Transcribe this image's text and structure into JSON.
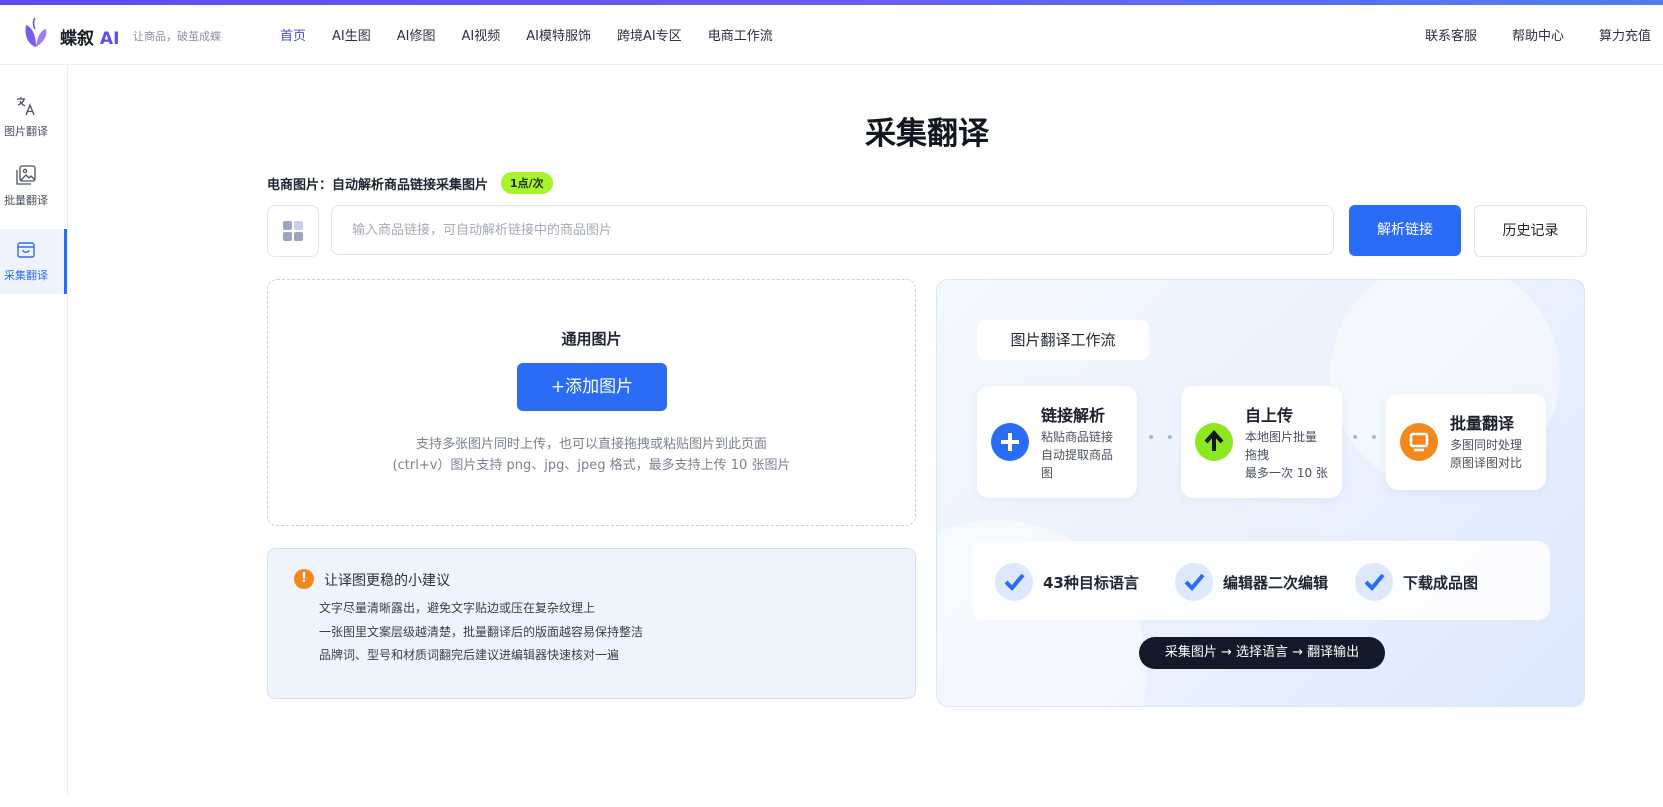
{
  "header": {
    "brand": "蝶叙",
    "brand_ai": "AI",
    "slogan": "让商品，破茧成蝶",
    "nav": [
      "首页",
      "AI生图",
      "AI修图",
      "AI视频",
      "AI模特服饰",
      "跨境AI专区",
      "电商工作流"
    ],
    "right_links": [
      "联系客服",
      "帮助中心",
      "算力充值"
    ]
  },
  "sidebar": {
    "items": [
      {
        "label": "图片翻译",
        "icon": "translate-icon"
      },
      {
        "label": "批量翻译",
        "icon": "images-icon"
      },
      {
        "label": "采集翻译",
        "icon": "basket-icon"
      }
    ]
  },
  "main": {
    "title": "采集翻译",
    "link_label": "电商图片：自动解析商品链接采集图片",
    "badge": "1点/次",
    "input_placeholder": "输入商品链接，可自动解析链接中的商品图片",
    "parse_button": "解析链接",
    "history_button": "历史记录"
  },
  "upload": {
    "title": "通用图片",
    "add_button": "+添加图片",
    "hint_line1": "支持多张图片同时上传，也可以直接拖拽或粘贴图片到此页面",
    "hint_line2": "(ctrl+v）图片支持 png、jpg、jpeg 格式，最多支持上传 10 张图片"
  },
  "tips": {
    "title": "让译图更稳的小建议",
    "lines": [
      "文字尽量清晰露出，避免文字贴边或压在复杂纹理上",
      "一张图里文案层级越清楚，批量翻译后的版面越容易保持整洁",
      "品牌词、型号和材质词翻完后建议进编辑器快速核对一遍"
    ]
  },
  "workflow": {
    "title": "图片翻译工作流",
    "cards": [
      {
        "title": "链接解析",
        "desc1": "粘贴商品链接",
        "desc2": "自动提取商品",
        "desc3": "图"
      },
      {
        "title": "自上传",
        "desc1": "本地图片批量",
        "desc2": "拖拽",
        "desc3": "最多一次 10 张"
      },
      {
        "title": "批量翻译",
        "desc1": "多图同时处理",
        "desc2": "原图译图对比"
      }
    ],
    "features": [
      "43种目标语言",
      "编辑器二次编辑",
      "下载成品图"
    ],
    "flow_pill": "采集图片 → 选择语言 → 翻译输出"
  },
  "colors": {
    "accent": "#2b6cf6",
    "nav_active": "#4a4ae8",
    "badge": "#a8f32a",
    "card_icon_1": "#2b6cf6",
    "card_icon_2": "#8ee81f",
    "card_icon_3": "#f5871f"
  }
}
